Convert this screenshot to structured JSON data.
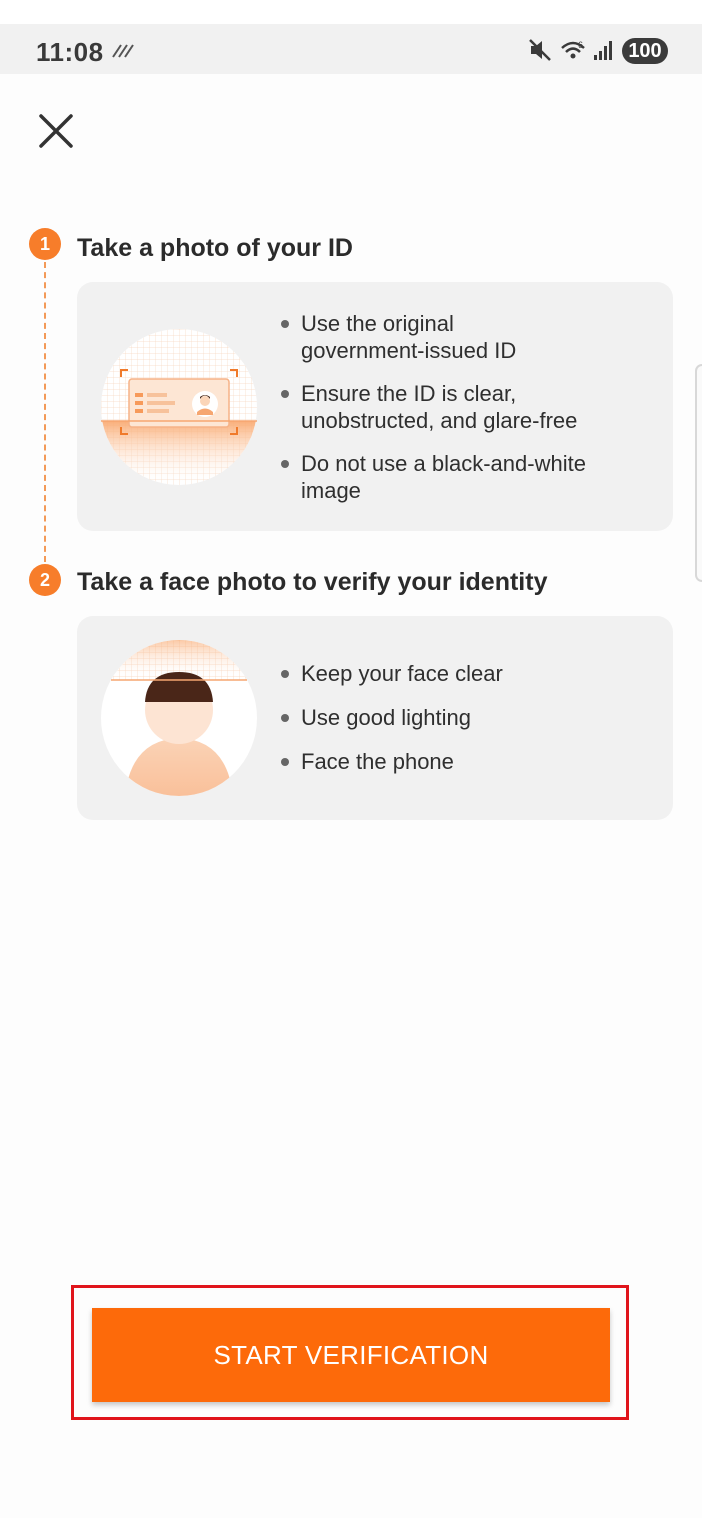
{
  "status_bar": {
    "time": "11:08",
    "battery": "100",
    "icons": [
      "signal-weak-icon",
      "mute-icon",
      "wifi-icon",
      "cell-signal-icon",
      "battery-icon"
    ]
  },
  "header": {
    "close_icon": "close-icon"
  },
  "steps": [
    {
      "number": "1",
      "title": "Take a photo of your ID",
      "illustration": "id-card-illustration",
      "tips": [
        "Use the original government-issued ID",
        "Ensure the ID is clear, unobstructed, and glare-free",
        "Do not use a black-and-white image"
      ]
    },
    {
      "number": "2",
      "title": "Take a face photo to verify your identity",
      "illustration": "face-illustration",
      "tips": [
        "Keep your face clear",
        "Use good lighting",
        "Face the phone"
      ]
    }
  ],
  "footer": {
    "start_label": "START VERIFICATION"
  },
  "colors": {
    "accent": "#fd6a0a",
    "step_dot": "#f77d2a",
    "highlight": "#e0141b",
    "card_bg": "#f1f1f1"
  }
}
